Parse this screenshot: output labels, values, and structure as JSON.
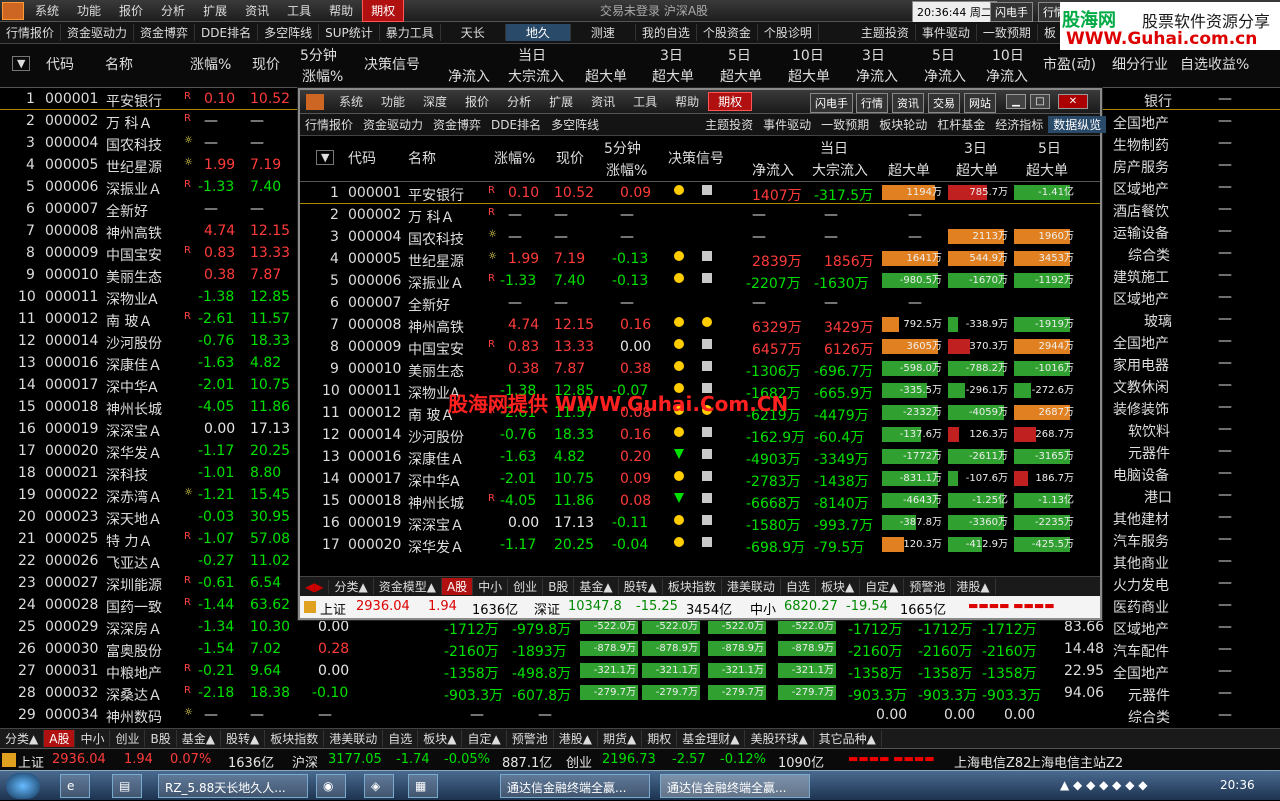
{
  "top_menu": {
    "items": [
      "系统",
      "功能",
      "报价",
      "分析",
      "扩展",
      "资讯",
      "工具",
      "帮助"
    ],
    "active": "期权",
    "status": "交易未登录  沪深A股",
    "clock": "20:36:44 周二",
    "btn1": "闪电手",
    "btn2": "行情"
  },
  "watermark": {
    "line1": "股海网",
    "line1b": "股票软件资源分享",
    "line2": "WWW.Guhai.com.cn",
    "center": "股海网提供 WWW.Guhai.Com.CN"
  },
  "toolbar": [
    "行情报价",
    "资金驱动力",
    "资金博弈",
    "DDE排名",
    "多空阵线",
    "SUP统计",
    "暴力工具",
    "天长",
    "地久",
    "测速",
    "我的自选",
    "个股资金",
    "个股诊明",
    "主题投资",
    "事件驱动",
    "一致预期",
    "板"
  ],
  "main_header": {
    "col_code": "代码",
    "col_name": "名称",
    "col_chg": "涨幅%",
    "col_price": "现价",
    "col_5min": "5分钟",
    "col_5min2": "涨幅%",
    "col_signal": "决策信号",
    "col_today": "当日",
    "col_netin": "净流入",
    "col_bulk": "大宗流入",
    "col_super": "超大单",
    "col_3d": "3日",
    "col_5d": "5日",
    "col_10d": "10日",
    "col_pe": "市盈(动)",
    "col_industry": "细分行业",
    "col_fav": "自选收益%"
  },
  "main_rows": [
    {
      "n": "1",
      "code": "000001",
      "name": "平安银行",
      "badge": "R",
      "chg": "0.10",
      "price": "10.52",
      "c5": "",
      "ind": "银行"
    },
    {
      "n": "2",
      "code": "000002",
      "name": "万 科Ａ",
      "badge": "R",
      "chg": "—",
      "price": "—",
      "c5": "",
      "ind": "全国地产"
    },
    {
      "n": "3",
      "code": "000004",
      "name": "国农科技",
      "badge": "☼",
      "chg": "—",
      "price": "—",
      "c5": "",
      "ind": "生物制药"
    },
    {
      "n": "4",
      "code": "000005",
      "name": "世纪星源",
      "badge": "☼",
      "chg": "1.99",
      "price": "7.19",
      "c5": "",
      "ind": "房产服务"
    },
    {
      "n": "5",
      "code": "000006",
      "name": "深振业Ａ",
      "badge": "R",
      "chg": "-1.33",
      "price": "7.40",
      "c5": "",
      "ind": "区域地产"
    },
    {
      "n": "6",
      "code": "000007",
      "name": "全新好",
      "badge": "",
      "chg": "—",
      "price": "—",
      "c5": "",
      "ind": "酒店餐饮"
    },
    {
      "n": "7",
      "code": "000008",
      "name": "神州高铁",
      "badge": "",
      "chg": "4.74",
      "price": "12.15",
      "c5": "",
      "ind": "运输设备"
    },
    {
      "n": "8",
      "code": "000009",
      "name": "中国宝安",
      "badge": "R",
      "chg": "0.83",
      "price": "13.33",
      "c5": "",
      "ind": "综合类"
    },
    {
      "n": "9",
      "code": "000010",
      "name": "美丽生态",
      "badge": "",
      "chg": "0.38",
      "price": "7.87",
      "c5": "",
      "ind": "建筑施工"
    },
    {
      "n": "10",
      "code": "000011",
      "name": "深物业A",
      "badge": "",
      "chg": "-1.38",
      "price": "12.85",
      "c5": "",
      "ind": "区域地产"
    },
    {
      "n": "11",
      "code": "000012",
      "name": "南 玻Ａ",
      "badge": "R",
      "chg": "-2.61",
      "price": "11.57",
      "c5": "",
      "ind": "玻璃"
    },
    {
      "n": "12",
      "code": "000014",
      "name": "沙河股份",
      "badge": "",
      "chg": "-0.76",
      "price": "18.33",
      "c5": "",
      "ind": "全国地产"
    },
    {
      "n": "13",
      "code": "000016",
      "name": "深康佳Ａ",
      "badge": "",
      "chg": "-1.63",
      "price": "4.82",
      "c5": "",
      "ind": "家用电器"
    },
    {
      "n": "14",
      "code": "000017",
      "name": "深中华A",
      "badge": "",
      "chg": "-2.01",
      "price": "10.75",
      "c5": "",
      "ind": "文教休闲"
    },
    {
      "n": "15",
      "code": "000018",
      "name": "神州长城",
      "badge": "",
      "chg": "-4.05",
      "price": "11.86",
      "c5": "",
      "ind": "装修装饰"
    },
    {
      "n": "16",
      "code": "000019",
      "name": "深深宝Ａ",
      "badge": "",
      "chg": "0.00",
      "price": "17.13",
      "c5": "",
      "ind": "软饮料"
    },
    {
      "n": "17",
      "code": "000020",
      "name": "深华发Ａ",
      "badge": "",
      "chg": "-1.17",
      "price": "20.25",
      "c5": "",
      "ind": "元器件"
    },
    {
      "n": "18",
      "code": "000021",
      "name": "深科技",
      "badge": "",
      "chg": "-1.01",
      "price": "8.80",
      "c5": "",
      "ind": "电脑设备"
    },
    {
      "n": "19",
      "code": "000022",
      "name": "深赤湾Ａ",
      "badge": "☼",
      "chg": "-1.21",
      "price": "15.45",
      "c5": "",
      "ind": "港口"
    },
    {
      "n": "20",
      "code": "000023",
      "name": "深天地Ａ",
      "badge": "",
      "chg": "-0.03",
      "price": "30.95",
      "c5": "",
      "ind": "其他建材"
    },
    {
      "n": "21",
      "code": "000025",
      "name": "特 力Ａ",
      "badge": "R",
      "chg": "-1.07",
      "price": "57.08",
      "c5": "",
      "ind": "汽车服务"
    },
    {
      "n": "22",
      "code": "000026",
      "name": "飞亚达Ａ",
      "badge": "",
      "chg": "-0.27",
      "price": "11.02",
      "c5": "",
      "ind": "其他商业"
    },
    {
      "n": "23",
      "code": "000027",
      "name": "深圳能源",
      "badge": "R",
      "chg": "-0.61",
      "price": "6.54",
      "c5": "",
      "ind": "火力发电"
    },
    {
      "n": "24",
      "code": "000028",
      "name": "国药一致",
      "badge": "R",
      "chg": "-1.44",
      "price": "63.62",
      "c5": "",
      "ind": "医药商业"
    },
    {
      "n": "25",
      "code": "000029",
      "name": "深深房Ａ",
      "badge": "",
      "chg": "-1.34",
      "price": "10.30",
      "c5": "0.00",
      "net": "-1712万",
      "bulk": "-979.8万",
      "sup": "-522.0万",
      "pe": "83.66",
      "ind": "区域地产"
    },
    {
      "n": "26",
      "code": "000030",
      "name": "富奥股份",
      "badge": "",
      "chg": "-1.54",
      "price": "7.02",
      "c5": "0.28",
      "net": "-2160万",
      "bulk": "-1893万",
      "sup": "-878.9万",
      "pe": "14.48",
      "ind": "汽车配件"
    },
    {
      "n": "27",
      "code": "000031",
      "name": "中粮地产",
      "badge": "R",
      "chg": "-0.21",
      "price": "9.64",
      "c5": "0.00",
      "net": "-1358万",
      "bulk": "-498.8万",
      "sup": "-321.1万",
      "pe": "22.95",
      "ind": "全国地产"
    },
    {
      "n": "28",
      "code": "000032",
      "name": "深桑达Ａ",
      "badge": "R",
      "chg": "-2.18",
      "price": "18.38",
      "c5": "-0.10",
      "net": "-903.3万",
      "bulk": "-607.8万",
      "sup": "-279.7万",
      "pe": "94.06",
      "ind": "元器件"
    },
    {
      "n": "29",
      "code": "000034",
      "name": "神州数码",
      "badge": "☼",
      "chg": "—",
      "price": "—",
      "c5": "—",
      "net": "—",
      "bulk": "—",
      "sup": "0.00",
      "pe": "",
      "ind": "综合类"
    }
  ],
  "main_tabs": [
    "分类▲",
    "A股",
    "中小",
    "创业",
    "B股",
    "基金▲",
    "股转▲",
    "板块指数",
    "港美联动",
    "自选",
    "板块▲",
    "自定▲",
    "预警池",
    "港股▲",
    "期货▲",
    "期权",
    "基金理财▲",
    "美股环球▲",
    "其它品种▲"
  ],
  "main_ticker": {
    "sh_label": "上证",
    "sh_val": "2936.04",
    "sh_chg": "1.94",
    "sh_pct": "0.07%",
    "sh_amt": "1636亿",
    "hs_label": "沪深",
    "hs_val": "3177.05",
    "hs_chg": "-1.74",
    "hs_pct": "-0.05%",
    "hs_amt": "887.1亿",
    "cy_label": "创业",
    "cy_val": "2196.73",
    "cy_chg": "-2.57",
    "cy_pct": "-0.12%",
    "cy_amt": "1090亿",
    "server1": "上海电信Z82",
    "server2": "上海电信主站Z2"
  },
  "taskbar": {
    "btn1": "RZ_5.88天长地久人...",
    "btn2": "通达信金融终端全赢...",
    "btn3": "通达信金融终端全赢...",
    "time": "20:36"
  },
  "win": {
    "menu": [
      "系统",
      "功能",
      "深度",
      "报价",
      "分析",
      "扩展",
      "资讯",
      "工具",
      "帮助"
    ],
    "active": "期权",
    "rbtns": [
      "闪电手",
      "行情",
      "资讯",
      "交易",
      "网站"
    ],
    "toolbar": [
      "行情报价",
      "资金驱动力",
      "资金博弈",
      "DDE排名",
      "多空阵线",
      "主题投资",
      "事件驱动",
      "一致预期",
      "板块轮动",
      "杠杆基金",
      "经济指标",
      "数据纵览"
    ],
    "header": {
      "code": "代码",
      "name": "名称",
      "chg": "涨幅%",
      "price": "现价",
      "m5a": "5分钟",
      "m5b": "涨幅%",
      "signal": "决策信号",
      "today": "当日",
      "netin": "净流入",
      "bulk": "大宗流入",
      "super": "超大单",
      "d3": "3日",
      "d3b": "超大单",
      "d5": "5日",
      "d5b": "超大单"
    },
    "rows": [
      {
        "n": "1",
        "code": "000001",
        "name": "平安银行",
        "badge": "R",
        "chg": "0.10",
        "price": "10.52",
        "c5": "0.09",
        "sig": "dot",
        "sq": true,
        "net": "1407万",
        "bulk": "-317.5万",
        "s1": "1194万",
        "s1c": "#e08020",
        "s1w": 0.95,
        "s3": "785.7万",
        "s3c": "#c02020",
        "s3w": 0.7,
        "s5": "-1.41亿",
        "s5c": "#30a030",
        "s5w": 1.0
      },
      {
        "n": "2",
        "code": "000002",
        "name": "万 科Ａ",
        "badge": "R",
        "chg": "—",
        "price": "—",
        "c5": "—",
        "sig": "",
        "sq": false,
        "net": "—",
        "bulk": "—",
        "s1": "—",
        "s1c": "",
        "s1w": 0,
        "s3": "",
        "s3c": "",
        "s3w": 0,
        "s5": "",
        "s5c": "",
        "s5w": 0
      },
      {
        "n": "3",
        "code": "000004",
        "name": "国农科技",
        "badge": "☼",
        "chg": "—",
        "price": "—",
        "c5": "—",
        "sig": "",
        "sq": false,
        "net": "—",
        "bulk": "—",
        "s1": "—",
        "s1c": "",
        "s1w": 0,
        "s3": "2113万",
        "s3c": "#e08020",
        "s3w": 1.0,
        "s5": "1960万",
        "s5c": "#e08020",
        "s5w": 1.0
      },
      {
        "n": "4",
        "code": "000005",
        "name": "世纪星源",
        "badge": "☼",
        "chg": "1.99",
        "price": "7.19",
        "c5": "-0.13",
        "sig": "dot",
        "sq": true,
        "net": "2839万",
        "bulk": "1856万",
        "s1": "1641万",
        "s1c": "#e08020",
        "s1w": 1.0,
        "s3": "544.9万",
        "s3c": "#e08020",
        "s3w": 1.0,
        "s5": "3453万",
        "s5c": "#e08020",
        "s5w": 1.0
      },
      {
        "n": "5",
        "code": "000006",
        "name": "深振业Ａ",
        "badge": "R",
        "chg": "-1.33",
        "price": "7.40",
        "c5": "-0.13",
        "sig": "dot",
        "sq": true,
        "net": "-2207万",
        "bulk": "-1630万",
        "s1": "-980.5万",
        "s1c": "#30a030",
        "s1w": 1.0,
        "s3": "-1670万",
        "s3c": "#30a030",
        "s3w": 1.0,
        "s5": "-1192万",
        "s5c": "#30a030",
        "s5w": 1.0
      },
      {
        "n": "6",
        "code": "000007",
        "name": "全新好",
        "badge": "",
        "chg": "—",
        "price": "—",
        "c5": "—",
        "sig": "",
        "sq": false,
        "net": "—",
        "bulk": "—",
        "s1": "—",
        "s1c": "",
        "s1w": 0,
        "s3": "",
        "s3c": "",
        "s3w": 0,
        "s5": "",
        "s5c": "",
        "s5w": 0
      },
      {
        "n": "7",
        "code": "000008",
        "name": "神州高铁",
        "badge": "",
        "chg": "4.74",
        "price": "12.15",
        "c5": "0.16",
        "sig": "dot2",
        "sq": false,
        "net": "6329万",
        "bulk": "3429万",
        "s1": "792.5万",
        "s1c": "#e08020",
        "s1w": 0.3,
        "s3": "-338.9万",
        "s3c": "#30a030",
        "s3w": 0.15,
        "s5": "-1919万",
        "s5c": "#30a030",
        "s5w": 1.0
      },
      {
        "n": "8",
        "code": "000009",
        "name": "中国宝安",
        "badge": "R",
        "chg": "0.83",
        "price": "13.33",
        "c5": "0.00",
        "sig": "dot",
        "sq": true,
        "net": "6457万",
        "bulk": "6126万",
        "s1": "3605万",
        "s1c": "#e08020",
        "s1w": 1.0,
        "s3": "370.3万",
        "s3c": "#c02020",
        "s3w": 0.4,
        "s5": "2944万",
        "s5c": "#e08020",
        "s5w": 1.0
      },
      {
        "n": "9",
        "code": "000010",
        "name": "美丽生态",
        "badge": "",
        "chg": "0.38",
        "price": "7.87",
        "c5": "0.38",
        "sig": "dot",
        "sq": true,
        "net": "-1306万",
        "bulk": "-696.7万",
        "s1": "-598.0万",
        "s1c": "#30a030",
        "s1w": 1.0,
        "s3": "-788.2万",
        "s3c": "#30a030",
        "s3w": 1.0,
        "s5": "-1016万",
        "s5c": "#30a030",
        "s5w": 1.0
      },
      {
        "n": "10",
        "code": "000011",
        "name": "深物业A",
        "badge": "",
        "chg": "-1.38",
        "price": "12.85",
        "c5": "-0.07",
        "sig": "dot",
        "sq": true,
        "net": "-1682万",
        "bulk": "-665.9万",
        "s1": "-335.5万",
        "s1c": "#30a030",
        "s1w": 0.8,
        "s3": "-296.1万",
        "s3c": "#30a030",
        "s3w": 0.3,
        "s5": "-272.6万",
        "s5c": "#30a030",
        "s5w": 0.3
      },
      {
        "n": "11",
        "code": "000012",
        "name": "南 玻Ａ",
        "badge": "R",
        "chg": "-2.61",
        "price": "11.57",
        "c5": "0.08",
        "sig": "dot2",
        "sq": false,
        "net": "-6219万",
        "bulk": "-4479万",
        "s1": "-2332万",
        "s1c": "#30a030",
        "s1w": 1.0,
        "s3": "-4059万",
        "s3c": "#30a030",
        "s3w": 1.0,
        "s5": "2687万",
        "s5c": "#e08020",
        "s5w": 1.0
      },
      {
        "n": "12",
        "code": "000014",
        "name": "沙河股份",
        "badge": "",
        "chg": "-0.76",
        "price": "18.33",
        "c5": "0.16",
        "sig": "dot",
        "sq": true,
        "net": "-162.9万",
        "bulk": "-60.4万",
        "s1": "-137.6万",
        "s1c": "#30a030",
        "s1w": 0.7,
        "s3": "126.3万",
        "s3c": "#c02020",
        "s3w": 0.2,
        "s5": "268.7万",
        "s5c": "#c02020",
        "s5w": 0.4
      },
      {
        "n": "13",
        "code": "000016",
        "name": "深康佳Ａ",
        "badge": "",
        "chg": "-1.63",
        "price": "4.82",
        "c5": "0.20",
        "sig": "tri",
        "sq": true,
        "net": "-4903万",
        "bulk": "-3349万",
        "s1": "-1772万",
        "s1c": "#30a030",
        "s1w": 1.0,
        "s3": "-2611万",
        "s3c": "#30a030",
        "s3w": 1.0,
        "s5": "-3165万",
        "s5c": "#30a030",
        "s5w": 1.0
      },
      {
        "n": "14",
        "code": "000017",
        "name": "深中华A",
        "badge": "",
        "chg": "-2.01",
        "price": "10.75",
        "c5": "0.09",
        "sig": "dot",
        "sq": true,
        "net": "-2783万",
        "bulk": "-1438万",
        "s1": "-831.1万",
        "s1c": "#30a030",
        "s1w": 1.0,
        "s3": "-107.6万",
        "s3c": "#30a030",
        "s3w": 0.15,
        "s5": "186.7万",
        "s5c": "#c02020",
        "s5w": 0.25
      },
      {
        "n": "15",
        "code": "000018",
        "name": "神州长城",
        "badge": "R",
        "chg": "-4.05",
        "price": "11.86",
        "c5": "0.08",
        "sig": "tri",
        "sq": true,
        "net": "-6668万",
        "bulk": "-8140万",
        "s1": "-4643万",
        "s1c": "#30a030",
        "s1w": 1.0,
        "s3": "-1.25亿",
        "s3c": "#30a030",
        "s3w": 1.0,
        "s5": "-1.13亿",
        "s5c": "#30a030",
        "s5w": 1.0
      },
      {
        "n": "16",
        "code": "000019",
        "name": "深深宝Ａ",
        "badge": "",
        "chg": "0.00",
        "price": "17.13",
        "c5": "-0.11",
        "sig": "dot",
        "sq": true,
        "net": "-1580万",
        "bulk": "-993.7万",
        "s1": "-387.8万",
        "s1c": "#30a030",
        "s1w": 0.6,
        "s3": "-3360万",
        "s3c": "#30a030",
        "s3w": 1.0,
        "s5": "-2235万",
        "s5c": "#30a030",
        "s5w": 1.0
      },
      {
        "n": "17",
        "code": "000020",
        "name": "深华发Ａ",
        "badge": "",
        "chg": "-1.17",
        "price": "20.25",
        "c5": "-0.04",
        "sig": "dot",
        "sq": true,
        "net": "-698.9万",
        "bulk": "-79.5万",
        "s1": "120.3万",
        "s1c": "#e08020",
        "s1w": 0.4,
        "s3": "-412.9万",
        "s3c": "#30a030",
        "s3w": 0.6,
        "s5": "-425.5万",
        "s5c": "#30a030",
        "s5w": 1.0
      }
    ],
    "tabs": [
      "分类▲",
      "资金模型▲",
      "A股",
      "中小",
      "创业",
      "B股",
      "基金▲",
      "股转▲",
      "板块指数",
      "港美联动",
      "自选",
      "板块▲",
      "自定▲",
      "预警池",
      "港股▲"
    ],
    "ticker": {
      "sh_label": "上证",
      "sh_val": "2936.04",
      "sh_chg": "1.94",
      "sh_amt": "1636亿",
      "sz_label": "深证",
      "sz_val": "10347.8",
      "sz_chg": "-15.25",
      "sz_amt": "3454亿",
      "zx_label": "中小",
      "zx_val": "6820.27",
      "zx_chg": "-19.54",
      "zx_amt": "1665亿"
    }
  },
  "colors": {
    "up": "#ff3b3b",
    "down": "#00e000",
    "accent": "#b01010"
  }
}
